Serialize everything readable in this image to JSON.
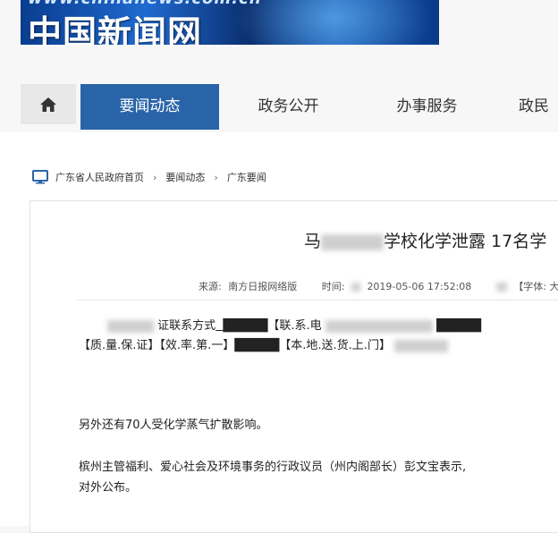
{
  "banner": {
    "url_text": "www.chinanews.com.cn",
    "brand": "中国新闻网"
  },
  "nav": {
    "tabs": [
      {
        "label": "要闻动态"
      },
      {
        "label": "政务公开"
      },
      {
        "label": "办事服务"
      },
      {
        "label": "政民"
      }
    ]
  },
  "breadcrumb": {
    "items": [
      "广东省人民政府首页",
      "要闻动态",
      "广东要闻"
    ]
  },
  "article": {
    "title_prefix": "马",
    "title_main": "学校化学泄露 17名学",
    "meta": {
      "source_label": "来源:",
      "source_value": "南方日报网络版",
      "time_label": "时间:",
      "time_value": "2019-05-06 17:52:08",
      "font_label": "【字体: 大"
    },
    "spam_line1_a": "证联系方式",
    "spam_line1_b": "█████【联.系.电",
    "spam_line1_c": "█████",
    "spam_line2_a": "【质.量.保.证】【效.率.第.一】█████【本.地.送.货.上.门】",
    "paragraph1": "另外还有70人受化学蒸气扩散影响。",
    "paragraph2_line1": "槟州主管福利、爱心社会及环境事务的行政议员（州内阁部长）彭文宝表示,",
    "paragraph2_line2": "对外公布。"
  },
  "colors": {
    "accent": "#2a64a8"
  }
}
